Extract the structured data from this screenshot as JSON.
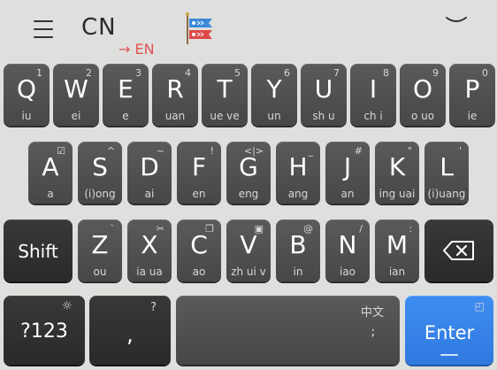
{
  "topbar": {
    "menu_icon": "hamburger-menu-icon",
    "language": "CN",
    "switch_hint": "→ EN",
    "flag_icon": "koinobori-flag-icon",
    "collapse_icon": "chevron-down-icon"
  },
  "colors": {
    "background": "#dfdfdd",
    "key": "#4f4f4f",
    "dark_key": "#303030",
    "enter_key": "#3a86ee",
    "switch_hint": "#e05252"
  },
  "row1": [
    {
      "main": "Q",
      "top": "1",
      "bot": "iu"
    },
    {
      "main": "W",
      "top": "2",
      "bot": "ei"
    },
    {
      "main": "E",
      "top": "3",
      "bot": "e"
    },
    {
      "main": "R",
      "top": "4",
      "bot": "uan"
    },
    {
      "main": "T",
      "top": "5",
      "bot": "ue ve"
    },
    {
      "main": "Y",
      "top": "6",
      "bot": "un"
    },
    {
      "main": "U",
      "top": "7",
      "bot": "sh u"
    },
    {
      "main": "I",
      "top": "8",
      "bot": "ch i"
    },
    {
      "main": "O",
      "top": "9",
      "bot": "o uo"
    },
    {
      "main": "P",
      "top": "0",
      "bot": "ie"
    }
  ],
  "row2": [
    {
      "main": "A",
      "top": "☑",
      "bot": "a"
    },
    {
      "main": "S",
      "top": "^",
      "bot": "(i)ong"
    },
    {
      "main": "D",
      "top": "~",
      "bot": "ai"
    },
    {
      "main": "F",
      "top": "!",
      "bot": "en"
    },
    {
      "main": "G",
      "top": "<|>",
      "bot": "eng"
    },
    {
      "main": "H",
      "top": "_",
      "bot": "ang"
    },
    {
      "main": "J",
      "top": "#",
      "bot": "an"
    },
    {
      "main": "K",
      "top": "\"",
      "bot": "ing uai"
    },
    {
      "main": "L",
      "top": "'",
      "bot": "(i)uang"
    }
  ],
  "row3": [
    {
      "main": "Z",
      "top": "`",
      "bot": "ou"
    },
    {
      "main": "X",
      "top": "✂",
      "bot": "ia ua"
    },
    {
      "main": "C",
      "top": "❐",
      "bot": "ao"
    },
    {
      "main": "V",
      "top": "▣",
      "bot": "zh ui v"
    },
    {
      "main": "B",
      "top": "@",
      "bot": "in"
    },
    {
      "main": "N",
      "top": "/",
      "bot": "iao"
    },
    {
      "main": "M",
      "top": ":",
      "bot": "ian"
    }
  ],
  "shift": {
    "label": "Shift"
  },
  "backspace": {
    "icon": "backspace-icon"
  },
  "bottom": {
    "num_label": "?123",
    "num_top": "☼",
    "comma_label": ",",
    "comma_top": "?",
    "space_top": "中文",
    "space_bot": ";",
    "enter_label": "Enter",
    "enter_top": "◰"
  }
}
